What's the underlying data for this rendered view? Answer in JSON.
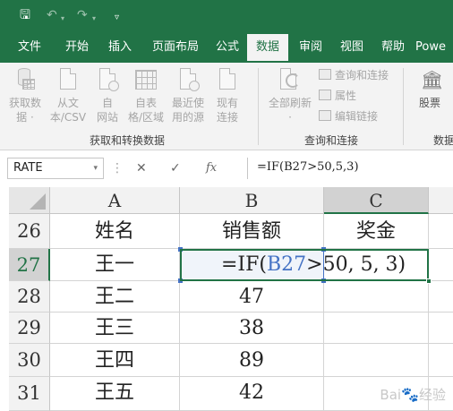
{
  "quick_access": {
    "save_icon": "save-icon",
    "undo_icon": "undo-icon",
    "redo_icon": "redo-icon",
    "customize_icon": "customize-icon"
  },
  "ribbon_tabs": [
    {
      "label": "文件",
      "active": false
    },
    {
      "label": "开始",
      "active": false
    },
    {
      "label": "插入",
      "active": false
    },
    {
      "label": "页面布局",
      "active": false
    },
    {
      "label": "公式",
      "active": false
    },
    {
      "label": "数据",
      "active": true
    },
    {
      "label": "审阅",
      "active": false
    },
    {
      "label": "视图",
      "active": false
    },
    {
      "label": "帮助",
      "active": false
    },
    {
      "label": "Powe",
      "active": false
    }
  ],
  "ribbon": {
    "get_transform": {
      "group_label": "获取和转换数据",
      "buttons": [
        {
          "line1": "获取数",
          "line2": "据 ·",
          "icon": "database-icon"
        },
        {
          "line1": "从文",
          "line2": "本/CSV",
          "icon": "text-file-icon"
        },
        {
          "line1": "自",
          "line2": "网站",
          "icon": "web-icon"
        },
        {
          "line1": "自表",
          "line2": "格/区域",
          "icon": "table-icon"
        },
        {
          "line1": "最近使",
          "line2": "用的源",
          "icon": "recent-sources-icon"
        },
        {
          "line1": "现有",
          "line2": "连接",
          "icon": "existing-connections-icon"
        }
      ]
    },
    "queries_connections": {
      "group_label": "查询和连接",
      "refresh_all_label": "全部刷新",
      "refresh_all_dd": "·",
      "items": [
        "查询和连接",
        "属性",
        "编辑链接"
      ]
    },
    "data_types": {
      "stocks_label": "股票",
      "group_label_partial": "数据"
    }
  },
  "formula_bar": {
    "name_box": "RATE",
    "name_box_dd": "▾",
    "colon": "⋮",
    "cancel": "✕",
    "enter": "✓",
    "fx": "fx",
    "formula": "=IF(B27>50,5,3)"
  },
  "sheet": {
    "columns": [
      "A",
      "B",
      "C"
    ],
    "rows": [
      {
        "num": "26",
        "a": "姓名",
        "b": "销售额",
        "c": "奖金"
      },
      {
        "num": "27",
        "a": "王一",
        "b": "",
        "c": ""
      },
      {
        "num": "28",
        "a": "王二",
        "b": "47",
        "c": ""
      },
      {
        "num": "29",
        "a": "王三",
        "b": "38",
        "c": ""
      },
      {
        "num": "30",
        "a": "王四",
        "b": "89",
        "c": ""
      },
      {
        "num": "31",
        "a": "王五",
        "b": "42",
        "c": ""
      }
    ],
    "active_cell_formula": {
      "prefix": "=IF(",
      "ref": "B27",
      "suffix": ">50, 5, 3)"
    }
  },
  "watermark": {
    "text": "Bai",
    "paw": "🐾",
    "text2": "经验"
  }
}
